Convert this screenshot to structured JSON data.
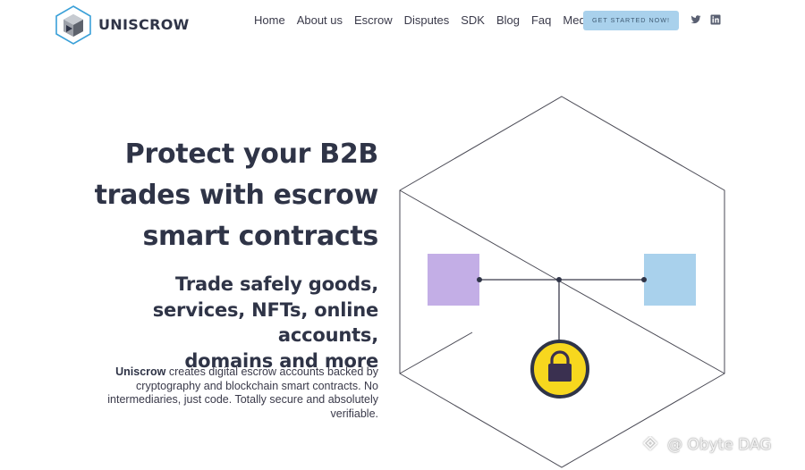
{
  "brand": {
    "name": "UNISCROW",
    "logo_icon": "uniscrow-cube-logo"
  },
  "nav": {
    "items": [
      "Home",
      "About us",
      "Escrow",
      "Disputes",
      "SDK",
      "Blog",
      "Faq",
      "Media"
    ],
    "cta_label": "GET STARTED NOW!",
    "social": [
      "twitter-icon",
      "linkedin-icon"
    ]
  },
  "hero": {
    "title_lines": [
      "Protect your B2B",
      "trades with escrow",
      "smart contracts"
    ],
    "subtitle_lines": [
      "Trade safely goods,",
      "services, NFTs, online accounts,",
      "domains and more"
    ],
    "description_brand": "Uniscrow",
    "description_rest": " creates digital escrow accounts backed by cryptography and blockchain smart contracts. No intermediaries, just code. Totally secure and absolutely verifiable."
  },
  "illustration": {
    "icon": "lock-icon",
    "left_box_color": "#c3aee6",
    "right_box_color": "#a9d1ec",
    "lock_circle_color": "#f7d71e"
  },
  "watermark": {
    "text": "@ Obyte DAG"
  },
  "colors": {
    "heading": "#2f3447",
    "text": "#3a3a4a",
    "cta_bg": "#a9d1ec"
  }
}
